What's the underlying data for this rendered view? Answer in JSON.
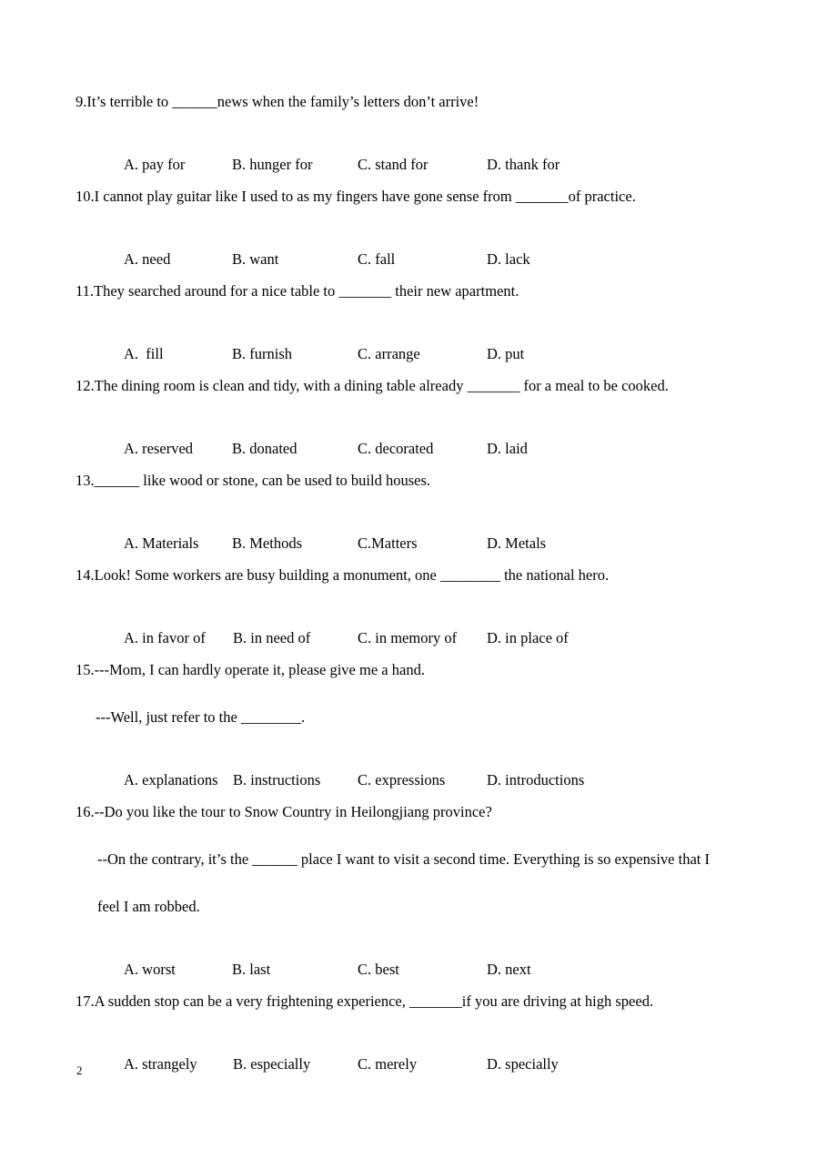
{
  "document": {
    "page_number": "2",
    "type": "multiple-choice-exam-worksheet"
  },
  "questions": [
    {
      "number": "9",
      "stem": "9.It’s terrible to ______news when the family’s letters don’t arrive!",
      "options": [
        "A. pay for",
        "B. hunger for",
        "C. stand for",
        "D. thank for"
      ]
    },
    {
      "number": "10",
      "stem": "10.I cannot play guitar like I used to as my fingers have gone sense from _______of practice.",
      "options": [
        "A. need",
        "B. want",
        "C. fall",
        "D. lack"
      ]
    },
    {
      "number": "11",
      "stem": "11.They searched around for a nice table to _______ their new apartment.",
      "options": [
        "A.  fill",
        "B. furnish",
        "C. arrange",
        "D. put"
      ]
    },
    {
      "number": "12",
      "stem": "12.The dining room is clean and tidy, with a dining table already _______ for a meal to be cooked.",
      "options": [
        "A. reserved",
        "B. donated",
        "C. decorated",
        "D. laid"
      ]
    },
    {
      "number": "13",
      "stem": "13.______ like wood or stone, can be used to build houses.",
      "options": [
        "A. Materials",
        "B. Methods",
        "C.Matters",
        "D. Metals"
      ]
    },
    {
      "number": "14",
      "stem": "14.Look! Some workers are busy building a monument, one ________ the national hero.",
      "options": [
        "A. in favor of",
        "B. in need of",
        "C. in memory of",
        "D. in place of"
      ]
    },
    {
      "number": "15",
      "stem": "15.---Mom, I can hardly operate it, please give me a hand.",
      "continuation": "---Well, just refer to the ________.",
      "options": [
        "A. explanations",
        "B. instructions",
        "C. expressions",
        "D. introductions"
      ]
    },
    {
      "number": "16",
      "stem": "16.--Do you like the tour to Snow Country in Heilongjiang province?",
      "continuation": "--On the contrary, it’s the ______ place I want to visit a second time. Everything is so expensive that I",
      "continuation_wrap": "feel I am robbed.",
      "options": [
        "A. worst",
        "B. last",
        "C. best",
        "D. next"
      ]
    },
    {
      "number": "17",
      "stem": "17.A sudden stop can be a very frightening experience, _______if you are driving at high speed.",
      "options": [
        "A. strangely",
        "B. especially",
        "C. merely",
        "D. specially"
      ]
    }
  ]
}
